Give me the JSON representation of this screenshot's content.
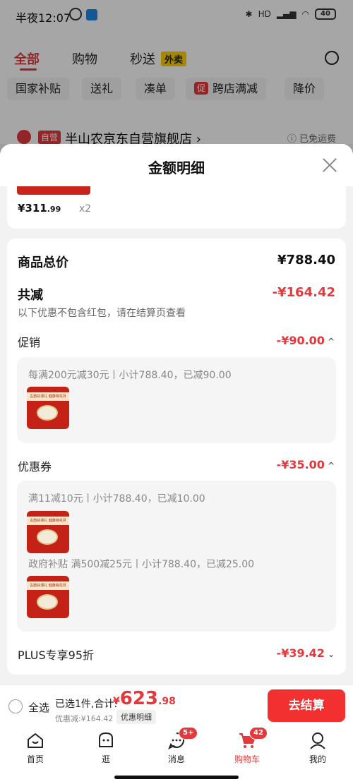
{
  "status_bar": {
    "time": "半夜12:07",
    "network": "HD",
    "battery": "40"
  },
  "background_page": {
    "tabs": [
      {
        "label": "全部"
      },
      {
        "label": "购物"
      },
      {
        "label": "秒送"
      }
    ],
    "waimai_tag": "外卖",
    "chips": [
      {
        "label": "国家补贴"
      },
      {
        "label": "送礼"
      },
      {
        "label": "凑单"
      },
      {
        "label": "跨店满减",
        "icon_text": "促"
      },
      {
        "label": "降价"
      }
    ],
    "store": {
      "badge": "自营",
      "name": "半山农京东自营旗舰店",
      "chevron": "›",
      "free_shipping": "已免运费"
    }
  },
  "sheet": {
    "title": "金额明细",
    "item": {
      "unit_price_main": "¥311",
      "unit_price_decimal": ".99",
      "qty": "x2"
    },
    "total_label": "商品总价",
    "total_value": "¥788.40",
    "discount_label": "共减",
    "discount_value": "-¥164.42",
    "discount_note": "以下优惠不包含红包，请在结算页查看",
    "promotion": {
      "label": "促销",
      "value": "-¥90.00",
      "chevron": "^",
      "detail": "每满200元减30元丨小计788.40，已减90.00"
    },
    "coupon": {
      "label": "优惠券",
      "value": "-¥35.00",
      "chevron": "^",
      "details": [
        "满11减10元丨小计788.40，已减10.00",
        "政府补贴 满500减25元丨小计788.40，已减25.00"
      ]
    },
    "plus": {
      "label": "PLUS专享95折",
      "value": "-¥39.42",
      "chevron": "⌄"
    },
    "thumb_caption": "古韵好漫礼 健康荷花月"
  },
  "checkout": {
    "select_all": "全选",
    "selected_text": "已选1件,合计:",
    "total_currency": "¥",
    "total_int": "623",
    "total_dec": ".98",
    "discount_text": "优惠减:¥164.42",
    "detail_button": "优惠明细",
    "pay_button": "去结算"
  },
  "tab_bar": {
    "items": [
      {
        "label": "首页"
      },
      {
        "label": "逛"
      },
      {
        "label": "消息",
        "badge": "5+"
      },
      {
        "label": "购物车",
        "badge": "42"
      },
      {
        "label": "我的"
      }
    ]
  },
  "colors": {
    "accent": "#e4393c",
    "pay_button": "#f23030"
  }
}
